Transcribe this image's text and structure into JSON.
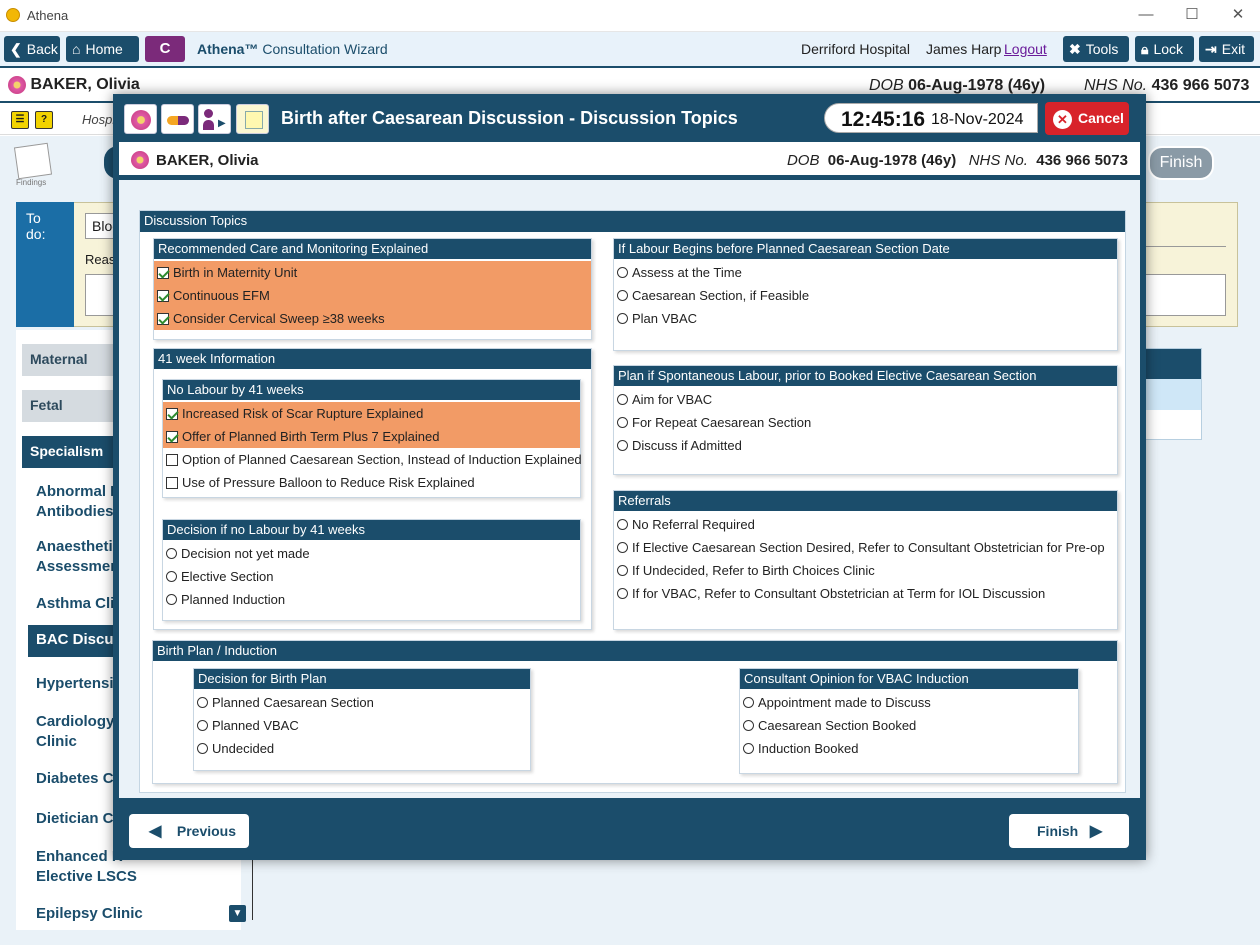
{
  "window": {
    "title": "Athena",
    "controls": [
      "—",
      "☐",
      "✕"
    ]
  },
  "toolbar": {
    "back": "Back",
    "home": "Home",
    "c_label": "C",
    "app_name": "Athena™",
    "app_sub": "Consultation Wizard",
    "hospital": "Derriford Hospital",
    "user": "James Harp",
    "logout": "Logout",
    "tools": "Tools",
    "lock": "Lock",
    "exit": "Exit"
  },
  "patient": {
    "name": "BAKER, Olivia",
    "dob_label": "DOB",
    "dob": "06-Aug-1978 (46y)",
    "nhs_label": "NHS No.",
    "nhs": "436 966 5073"
  },
  "background": {
    "hosp_stub": "Hospi",
    "todo_label": "To do:",
    "todo_field": "Bloo",
    "reason_stub": "Reas",
    "findings": "Findings",
    "finish": "Finish",
    "side_headers": [
      "Maternal",
      "Fetal",
      "Specialism"
    ],
    "side_items": [
      "Abnormal R\nAntibodies",
      "Anaesthetic\nAssessment",
      "Asthma Clin",
      "BAC Discuss",
      "Hypertensio",
      "Cardiology\nClinic",
      "Diabetes Cl",
      "Dietician Cl",
      "Enhanced R\nElective LSCS",
      "Epilepsy Clinic"
    ]
  },
  "dialog": {
    "title": "Birth after Caesarean Discussion - Discussion Topics",
    "time": "12:45:16",
    "date": "18-Nov-2024",
    "cancel": "Cancel",
    "previous": "Previous",
    "finish": "Finish",
    "panel_title": "Discussion Topics",
    "recommended": {
      "title": "Recommended Care and Monitoring Explained",
      "items": [
        "Birth in Maternity Unit",
        "Continuous EFM",
        "Consider Cervical Sweep ≥38 weeks"
      ]
    },
    "week41": {
      "title": "41 week Information",
      "no_labour": {
        "title": "No Labour by 41 weeks",
        "items": [
          "Increased Risk of Scar Rupture Explained",
          "Offer of Planned Birth Term Plus 7 Explained",
          "Option of Planned Caesarean Section, Instead of Induction Explained",
          "Use of Pressure Balloon to Reduce Risk Explained"
        ],
        "checked": [
          true,
          true,
          false,
          false
        ]
      },
      "decision": {
        "title": "Decision if no Labour by 41 weeks",
        "options": [
          "Decision not yet made",
          "Elective Section",
          "Planned Induction"
        ]
      }
    },
    "labour_before": {
      "title": "If Labour Begins before Planned Caesarean Section Date",
      "options": [
        "Assess at the Time",
        "Caesarean Section, if Feasible",
        "Plan VBAC"
      ]
    },
    "spontaneous": {
      "title": "Plan if Spontaneous Labour, prior to Booked Elective Caesarean Section",
      "options": [
        "Aim for VBAC",
        "For Repeat Caesarean Section",
        "Discuss if Admitted"
      ]
    },
    "referrals": {
      "title": "Referrals",
      "options": [
        "No Referral Required",
        "If Elective Caesarean Section Desired, Refer to Consultant Obstetrician for Pre-op",
        "If Undecided, Refer to Birth Choices Clinic",
        "If for VBAC, Refer to Consultant Obstetrician at Term for IOL Discussion"
      ]
    },
    "birth_plan": {
      "title": "Birth Plan / Induction",
      "decision": {
        "title": "Decision for Birth Plan",
        "options": [
          "Planned Caesarean Section",
          "Planned VBAC",
          "Undecided"
        ]
      },
      "consultant": {
        "title": "Consultant Opinion for VBAC Induction",
        "options": [
          "Appointment made to Discuss",
          "Caesarean Section Booked",
          "Induction Booked"
        ]
      }
    }
  },
  "colors": {
    "primary": "#1b4d6b",
    "selected_row": "#f29b66",
    "cancel": "#d8232a",
    "c_button": "#7b2a7a"
  }
}
